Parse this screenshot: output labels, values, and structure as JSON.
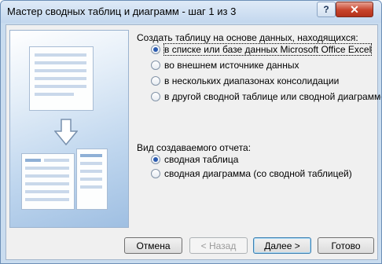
{
  "window": {
    "title": "Мастер сводных таблиц и диаграмм - шаг 1 из 3",
    "help_label": "?",
    "close_label": "✕"
  },
  "source_group": {
    "label": "Создать таблицу на основе данных, находящихся:",
    "options": [
      {
        "label": "в списке или базе данных Microsoft Office Excel",
        "checked": true
      },
      {
        "label": "во внешнем источнике данных",
        "checked": false
      },
      {
        "label": "в нескольких диапазонах консолидации",
        "checked": false
      },
      {
        "label": "в другой сводной таблице или сводной диаграмме",
        "checked": false
      }
    ]
  },
  "report_group": {
    "label": "Вид создаваемого отчета:",
    "options": [
      {
        "label": "сводная таблица",
        "checked": true
      },
      {
        "label": "сводная диаграмма (со сводной таблицей)",
        "checked": false
      }
    ]
  },
  "buttons": {
    "cancel": "Отмена",
    "back": "< Назад",
    "next": "Далее >",
    "finish": "Готово"
  },
  "icons": {
    "illustration": "pivot-wizard-illustration",
    "arrow": "down-arrow-icon"
  },
  "colors": {
    "accent": "#2b5bb0",
    "close": "#c7432b"
  }
}
